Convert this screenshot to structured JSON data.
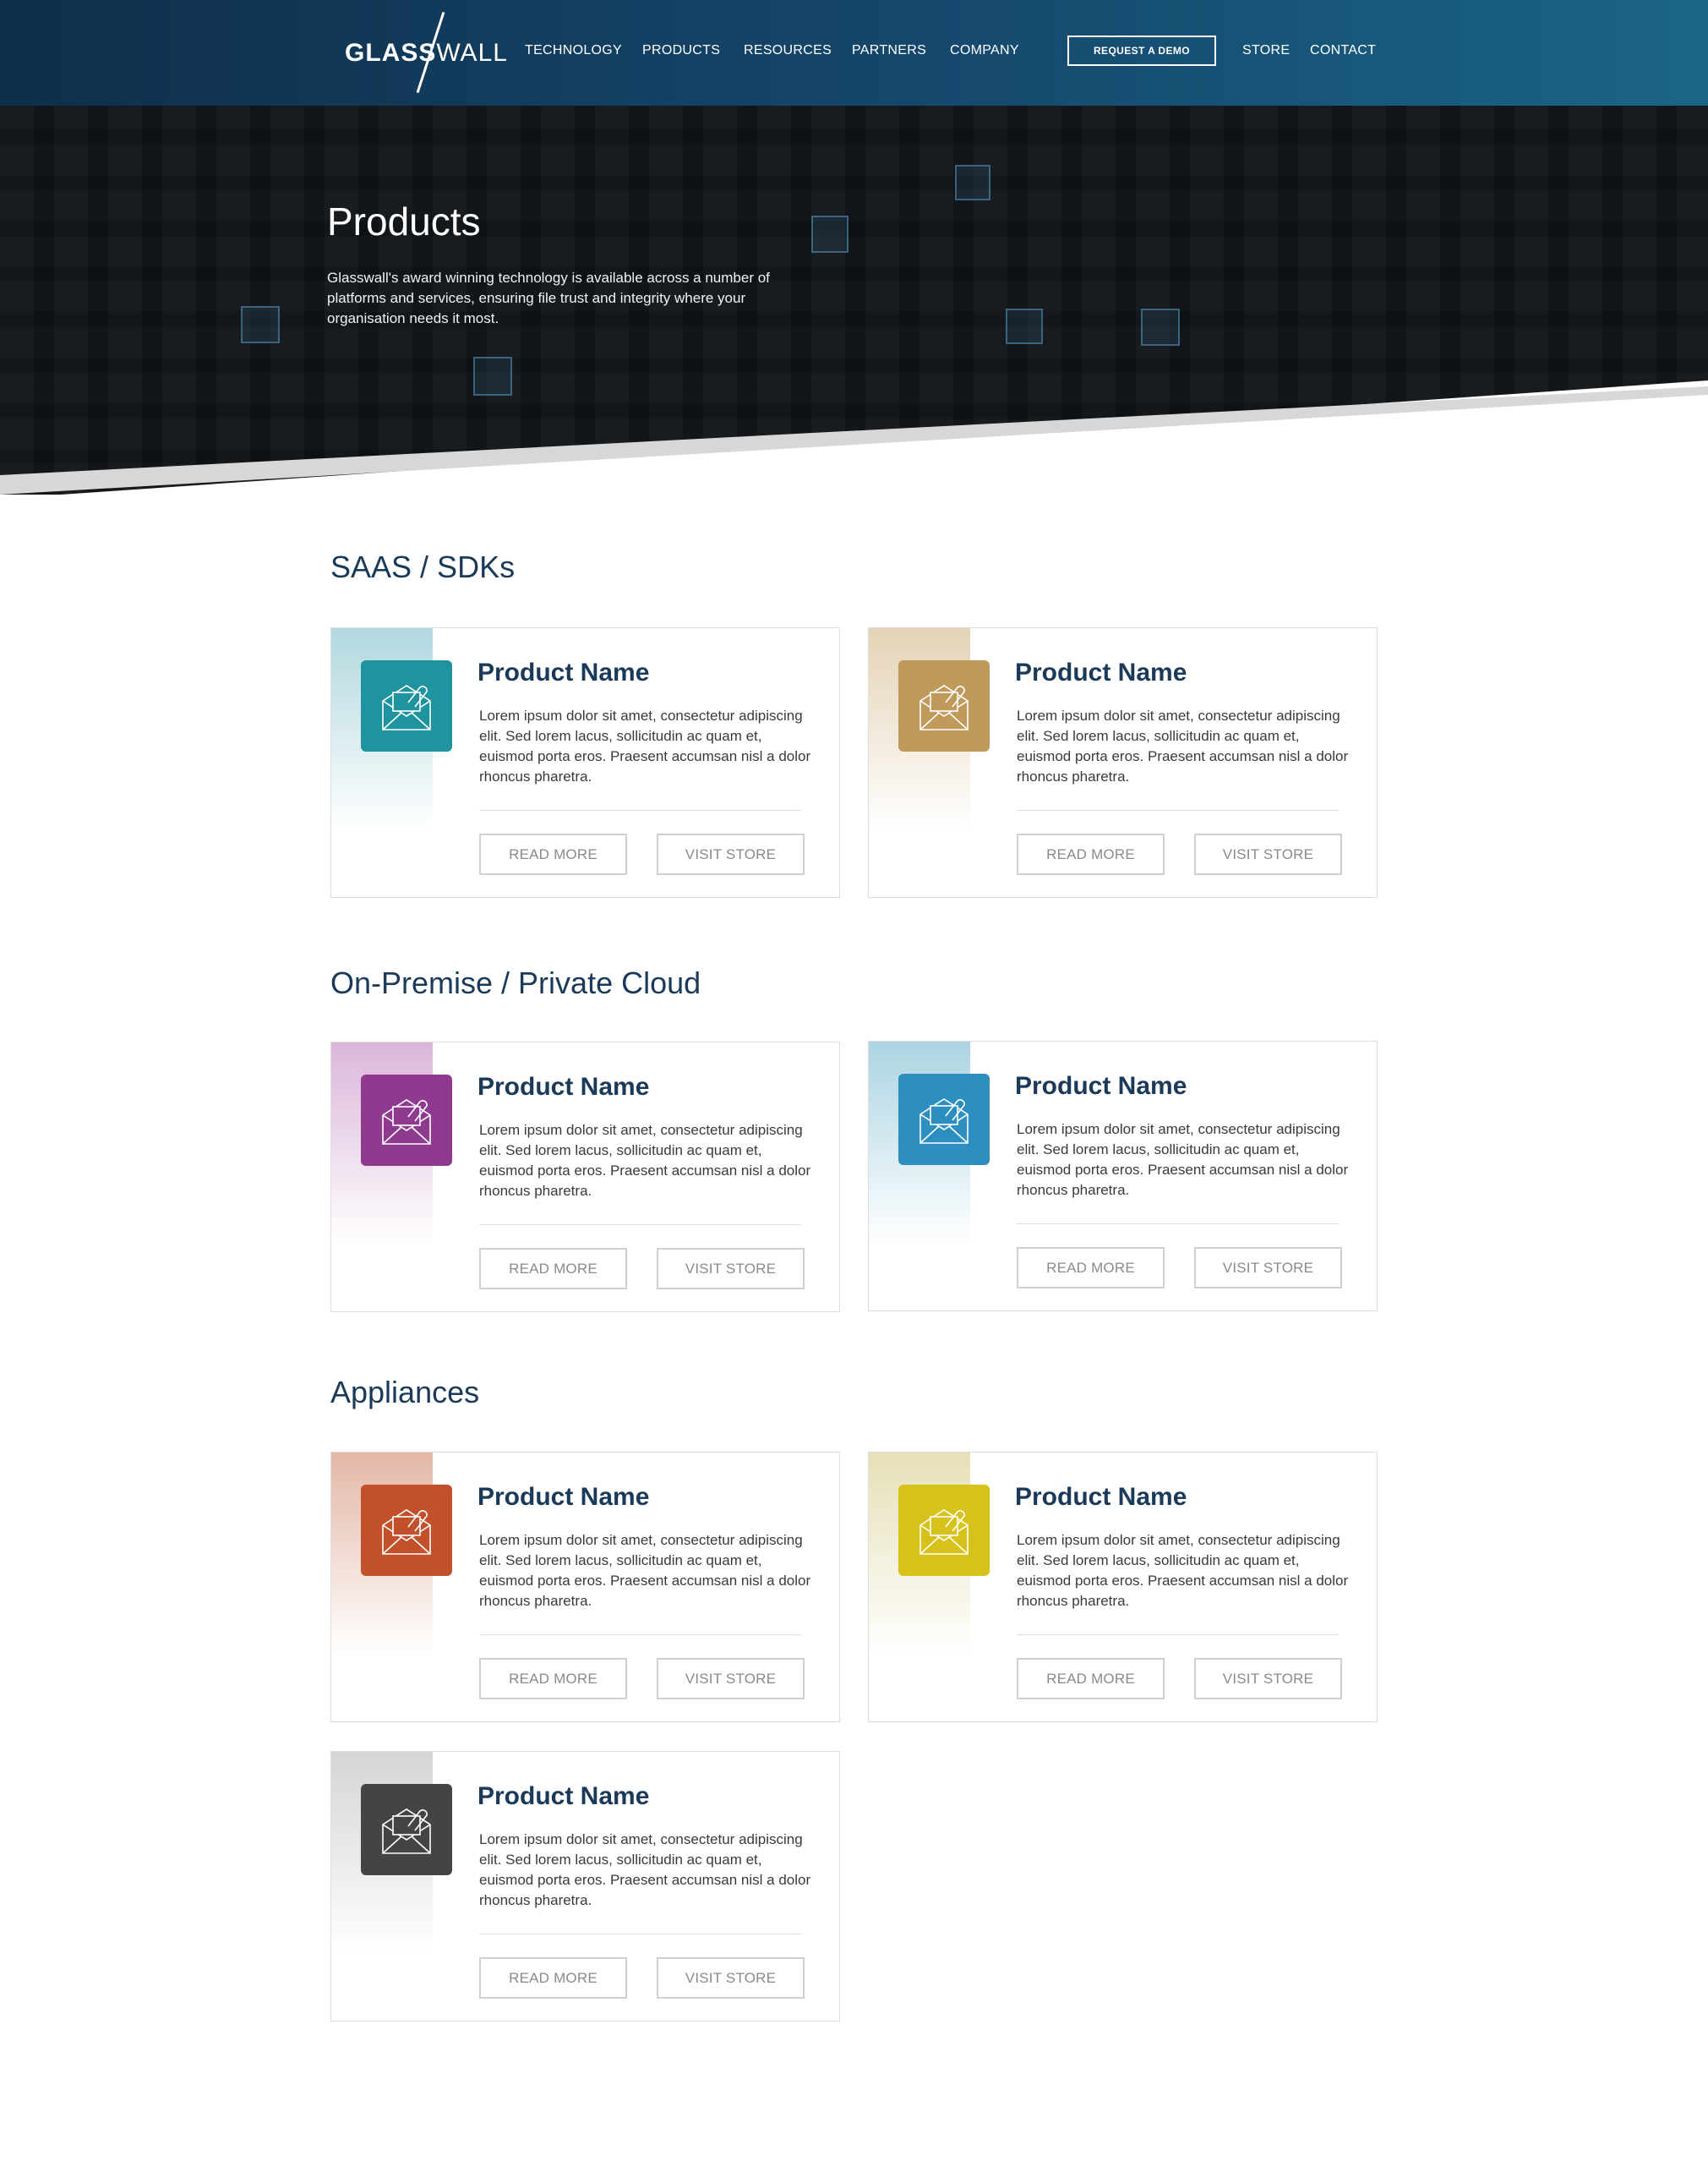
{
  "brand": {
    "logo_bold": "GLASS",
    "logo_light": "WALL"
  },
  "nav": {
    "items": [
      "TECHNOLOGY",
      "PRODUCTS",
      "RESOURCES",
      "PARTNERS",
      "COMPANY"
    ],
    "demo_button": "REQUEST A DEMO",
    "store": "STORE",
    "contact": "CONTACT"
  },
  "hero": {
    "title": "Products",
    "description": "Glasswall's award winning technology is available across a number of platforms and services, ensuring file trust and integrity where your organisation needs it most."
  },
  "sections": [
    {
      "title": "SAAS / SDKs",
      "cards": [
        {
          "title": "Product Name",
          "description": "Lorem ipsum dolor sit amet, consectetur adipiscing elit. Sed lorem lacus, sollicitudin ac quam et, euismod porta eros. Praesent accumsan nisl a dolor rhoncus pharetra.",
          "read_more": "READ MORE",
          "visit_store": "VISIT STORE",
          "color": "#1f949e",
          "band": "#b1d8de",
          "icon": "envelope-attachment-icon"
        },
        {
          "title": "Product Name",
          "description": "Lorem ipsum dolor sit amet, consectetur adipiscing elit. Sed lorem lacus, sollicitudin ac quam et, euismod porta eros. Praesent accumsan nisl a dolor rhoncus pharetra.",
          "read_more": "READ MORE",
          "visit_store": "VISIT STORE",
          "color": "#c09a5a",
          "band": "#e4d3b6",
          "icon": "envelope-attachment-icon"
        }
      ]
    },
    {
      "title": "On-Premise / Private Cloud",
      "cards": [
        {
          "title": "Product Name",
          "description": "Lorem ipsum dolor sit amet, consectetur adipiscing elit. Sed lorem lacus, sollicitudin ac quam et, euismod porta eros. Praesent accumsan nisl a dolor rhoncus pharetra.",
          "read_more": "READ MORE",
          "visit_store": "VISIT STORE",
          "color": "#8e3b8f",
          "band": "#dab6d9",
          "icon": "envelope-attachment-icon"
        },
        {
          "title": "Product Name",
          "description": "Lorem ipsum dolor sit amet, consectetur adipiscing elit. Sed lorem lacus, sollicitudin ac quam et, euismod porta eros. Praesent accumsan nisl a dolor rhoncus pharetra.",
          "read_more": "READ MORE",
          "visit_store": "VISIT STORE",
          "color": "#2d8fc0",
          "band": "#acd4e3",
          "icon": "envelope-attachment-icon"
        }
      ]
    },
    {
      "title": "Appliances",
      "cards": [
        {
          "title": "Product Name",
          "description": "Lorem ipsum dolor sit amet, consectetur adipiscing elit. Sed lorem lacus, sollicitudin ac quam et, euismod porta eros. Praesent accumsan nisl a dolor rhoncus pharetra.",
          "read_more": "READ MORE",
          "visit_store": "VISIT STORE",
          "color": "#c2502a",
          "band": "#e3b7a6",
          "icon": "envelope-attachment-icon"
        },
        {
          "title": "Product Name",
          "description": "Lorem ipsum dolor sit amet, consectetur adipiscing elit. Sed lorem lacus, sollicitudin ac quam et, euismod porta eros. Praesent accumsan nisl a dolor rhoncus pharetra.",
          "read_more": "READ MORE",
          "visit_store": "VISIT STORE",
          "color": "#d6c21b",
          "band": "#e6e0b7",
          "icon": "envelope-attachment-icon"
        },
        {
          "title": "Product Name",
          "description": "Lorem ipsum dolor sit amet, consectetur adipiscing elit. Sed lorem lacus, sollicitudin ac quam et, euismod porta eros. Praesent accumsan nisl a dolor rhoncus pharetra.",
          "read_more": "READ MORE",
          "visit_store": "VISIT STORE",
          "color": "#444444",
          "band": "#d5d5d5",
          "icon": "envelope-attachment-icon"
        }
      ]
    }
  ]
}
